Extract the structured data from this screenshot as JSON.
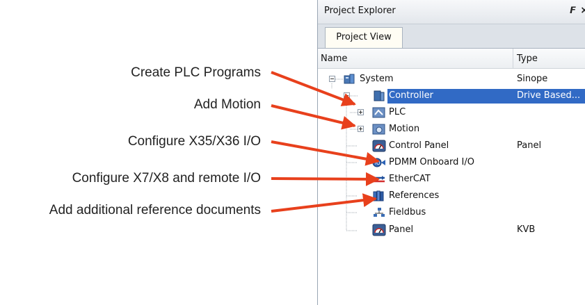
{
  "callouts": [
    "Create PLC Programs",
    "Add Motion",
    "Configure X35/X36 I/O",
    "Configure X7/X8 and remote I/O",
    "Add additional reference documents"
  ],
  "panel": {
    "title": "Project Explorer",
    "pin_glyph": "𝙁",
    "close_glyph": "×",
    "tab": "Project View",
    "columns": {
      "name": "Name",
      "type": "Type"
    }
  },
  "tree": [
    {
      "label": "System",
      "type": "Sinope",
      "icon": "system-icon"
    },
    {
      "label": "Controller",
      "type": "Drive Based...",
      "icon": "controller-icon",
      "selected": true
    },
    {
      "label": "PLC",
      "type": "",
      "icon": "plc-icon"
    },
    {
      "label": "Motion",
      "type": "",
      "icon": "motion-icon"
    },
    {
      "label": "Control Panel",
      "type": "Panel",
      "icon": "gauge-icon"
    },
    {
      "label": "PDMM Onboard I/O",
      "type": "",
      "icon": "io-icon"
    },
    {
      "label": "EtherCAT",
      "type": "",
      "icon": "ethercat-icon"
    },
    {
      "label": "References",
      "type": "",
      "icon": "books-icon"
    },
    {
      "label": "Fieldbus",
      "type": "",
      "icon": "network-icon"
    },
    {
      "label": "Panel",
      "type": "KVB",
      "icon": "gauge-icon"
    }
  ],
  "colors": {
    "selection": "#316ac5",
    "arrow": "#e8401c"
  }
}
